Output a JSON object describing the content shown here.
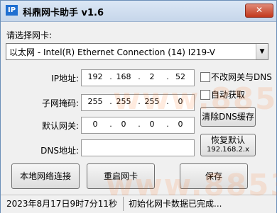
{
  "window": {
    "title": "科鼎网卡助手 v1.6",
    "icon_text": "IP",
    "close_symbol": "✕"
  },
  "adapter": {
    "label": "请选择网卡:",
    "selected": "以太网 - Intel(R) Ethernet Connection (14) I219-V",
    "arrow": "▼"
  },
  "fields": {
    "ip": {
      "label": "IP地址:",
      "octets": [
        "192",
        "168",
        "2",
        "52"
      ]
    },
    "mask": {
      "label": "子网掩码:",
      "octets": [
        "255",
        "255",
        "255",
        "0"
      ]
    },
    "gateway": {
      "label": "默认网关:",
      "octets": [
        "0",
        "0",
        "0",
        "0"
      ]
    },
    "dns": {
      "label": "DNS地址:",
      "value": ""
    }
  },
  "options": {
    "no_change_gateway_dns": {
      "label": "不改网关与DNS",
      "checked": false
    },
    "auto_obtain": {
      "label": "自动获取",
      "checked": false
    }
  },
  "buttons": {
    "clear_dns_cache": "清除DNS缓存",
    "restore_default_line1": "恢复默认",
    "restore_default_line2": "192.168.2.x",
    "local_connections": "本地网络连接",
    "restart_nic": "重启网卡",
    "save": "保存"
  },
  "status": {
    "datetime": "2023年8月17日9时7分11秒",
    "message": "初始化网卡数据已完成..."
  },
  "watermark": {
    "text": "www.88531.cn"
  }
}
